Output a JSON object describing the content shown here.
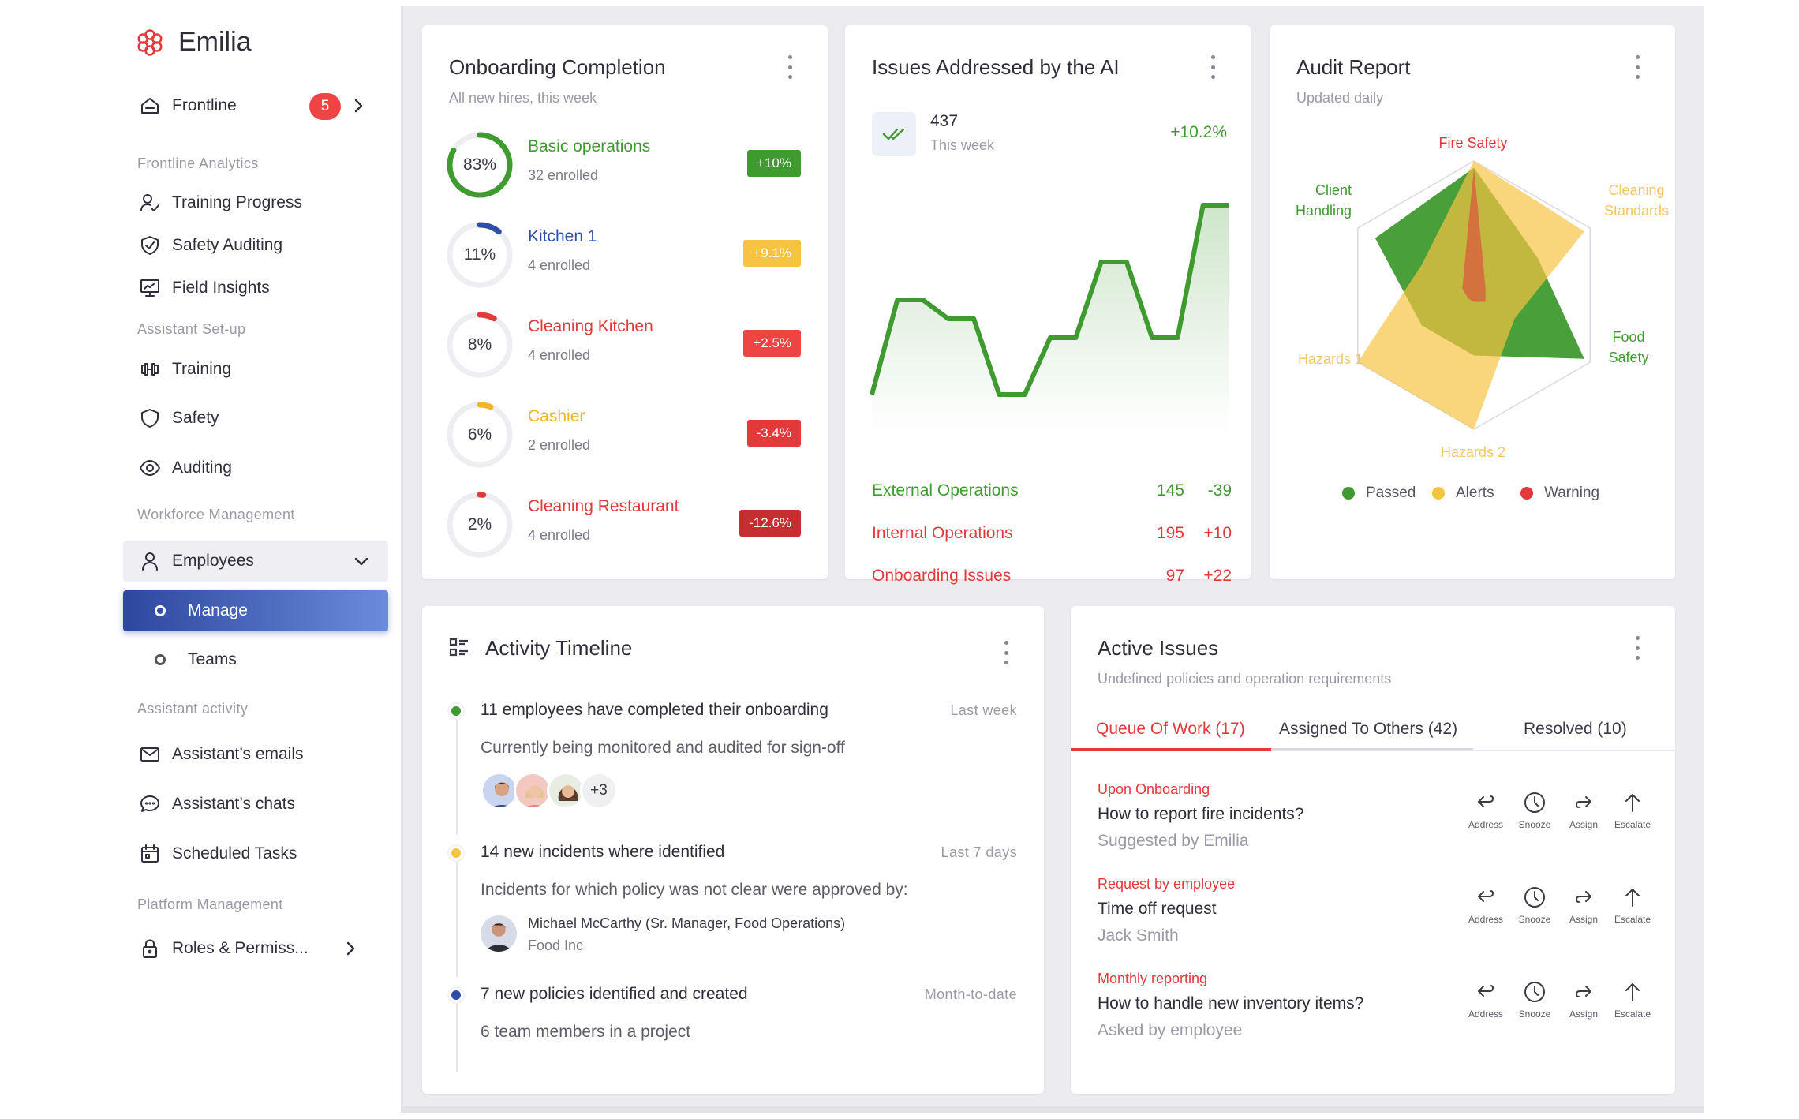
{
  "brand": {
    "name": "Emilia",
    "logo_icon": "flower-icon",
    "accent": "#e2393b"
  },
  "sidebar": {
    "frontline": {
      "label": "Frontline",
      "badge": "5",
      "icon": "home-icon"
    },
    "sections": {
      "analytics": "Frontline Analytics",
      "setup": "Assistant Set-up",
      "workforce": "Workforce Management",
      "activity": "Assistant activity",
      "platform": "Platform Management"
    },
    "analytics_items": [
      {
        "label": "Training Progress",
        "icon": "user-check-icon"
      },
      {
        "label": "Safety Auditing",
        "icon": "shield-check-icon"
      },
      {
        "label": "Field Insights",
        "icon": "monitor-chart-icon"
      }
    ],
    "setup_items": [
      {
        "label": "Training",
        "icon": "dumbbell-icon"
      },
      {
        "label": "Safety",
        "icon": "shield-icon"
      },
      {
        "label": "Auditing",
        "icon": "eye-icon"
      }
    ],
    "employees": {
      "label": "Employees",
      "icon": "user-icon",
      "children": [
        {
          "label": "Manage"
        },
        {
          "label": "Teams"
        }
      ]
    },
    "activity_items": [
      {
        "label": "Assistant’s emails",
        "icon": "mail-icon"
      },
      {
        "label": "Assistant’s chats",
        "icon": "chat-icon"
      },
      {
        "label": "Scheduled Tasks",
        "icon": "calendar-icon"
      }
    ],
    "platform_items": [
      {
        "label": "Roles & Permiss...",
        "icon": "lock-icon"
      }
    ]
  },
  "onboarding": {
    "title": "Onboarding Completion",
    "subtitle": "All new hires, this week",
    "rows": [
      {
        "pct_label": "83%",
        "pct": 83,
        "name": "Basic operations",
        "enrolled": "32 enrolled",
        "change": "+10%",
        "name_color": "#3f9a2f",
        "ring_color": "#3f9a2f",
        "chip_color": "#3f9a2f"
      },
      {
        "pct_label": "11%",
        "pct": 11,
        "name": "Kitchen 1",
        "enrolled": "4 enrolled",
        "change": "+9.1%",
        "name_color": "#2e4fa8",
        "ring_color": "#2e4fa8",
        "chip_color": "#f6c343"
      },
      {
        "pct_label": "8%",
        "pct": 8,
        "name": "Cleaning Kitchen",
        "enrolled": "4 enrolled",
        "change": "+2.5%",
        "name_color": "#e2393b",
        "ring_color": "#e2393b",
        "chip_color": "#ef4444"
      },
      {
        "pct_label": "6%",
        "pct": 6,
        "name": "Cashier",
        "enrolled": "2 enrolled",
        "change": "-3.4%",
        "name_color": "#f0b429",
        "ring_color": "#f0b429",
        "chip_color": "#e2393b"
      },
      {
        "pct_label": "2%",
        "pct": 2,
        "name": "Cleaning Restaurant",
        "enrolled": "4 enrolled",
        "change": "-12.6%",
        "name_color": "#e2393b",
        "ring_color": "#e2393b",
        "chip_color": "#c62f32"
      }
    ]
  },
  "ai": {
    "title": "Issues Addressed by the AI",
    "count": "437",
    "period": "This week",
    "change": "+10.2%",
    "icon": "double-check-icon",
    "series_color": "#3f9a2f",
    "chart_data": {
      "type": "area",
      "values": [
        0,
        5,
        5,
        4,
        4,
        0,
        0,
        3,
        3,
        7,
        7,
        3,
        3,
        10,
        10
      ]
    },
    "rows": [
      {
        "label": "External Operations",
        "value": "145",
        "delta": "-39",
        "color": "#3f9a2f"
      },
      {
        "label": "Internal Operations",
        "value": "195",
        "delta": "+10",
        "color": "#e2393b"
      },
      {
        "label": "Onboarding Issues",
        "value": "97",
        "delta": "+22",
        "color": "#e2393b"
      }
    ]
  },
  "audit": {
    "title": "Audit Report",
    "subtitle": "Updated daily",
    "axes": [
      "Fire Safety",
      "Cleaning\nStandards",
      "Food\nSafety",
      "Hazards 2",
      "Hazards 1",
      "Client\nHandling"
    ],
    "axis_colors": [
      "#e2393b",
      "#f0c66a",
      "#3f9a2f",
      "#f0c66a",
      "#f0c66a",
      "#3f9a2f"
    ],
    "chart_data": {
      "type": "radar",
      "max": 1,
      "series": [
        {
          "name": "Passed",
          "color": "#3f9a2f",
          "values": [
            0.95,
            0.55,
            0.95,
            0.45,
            0.45,
            0.85
          ]
        },
        {
          "name": "Alerts",
          "color": "#f6c343",
          "values": [
            1.0,
            0.95,
            0.35,
            1.0,
            1.0,
            0.45
          ]
        },
        {
          "name": "Warning",
          "color": "#e2393b",
          "values": [
            0.95,
            0.1,
            0.1,
            0.05,
            0.05,
            0.1
          ]
        }
      ]
    },
    "legend": [
      {
        "label": "Passed",
        "color": "#3f9a2f"
      },
      {
        "label": "Alerts",
        "color": "#f6c343"
      },
      {
        "label": "Warning",
        "color": "#e2393b"
      }
    ]
  },
  "timeline": {
    "title": "Activity Timeline",
    "icon": "timeline-list-icon",
    "items": [
      {
        "title": "11 employees have completed their onboarding",
        "time": "Last week",
        "text": "Currently being monitored and audited for sign-off",
        "dot": "#3f9a2f",
        "more": "+3"
      },
      {
        "title": "14 new incidents where identified",
        "time": "Last 7 days",
        "text": "Incidents for which policy was not clear were approved by:",
        "dot": "#f6c343",
        "person": "Michael McCarthy (Sr. Manager, Food Operations)",
        "company": "Food Inc"
      },
      {
        "title": "7 new policies identified and created",
        "time": "Month-to-date",
        "text": "6 team members in a project",
        "dot": "#2e4fa8"
      }
    ]
  },
  "issues": {
    "title": "Active Issues",
    "subtitle": "Undefined policies and operation requirements",
    "tabs": [
      "Queue Of Work (17)",
      "Assigned To Others (42)",
      "Resolved (10)"
    ],
    "actions": [
      {
        "label": "Address",
        "icon": "reply-icon"
      },
      {
        "label": "Snooze",
        "icon": "clock-icon"
      },
      {
        "label": "Assign",
        "icon": "forward-icon"
      },
      {
        "label": "Escalate",
        "icon": "arrow-up-icon"
      }
    ],
    "items": [
      {
        "category": "Upon Onboarding",
        "question": "How to report fire incidents?",
        "by": "Suggested by Emilia"
      },
      {
        "category": "Request by employee",
        "question": "Time off request",
        "by": "Jack Smith"
      },
      {
        "category": "Monthly reporting",
        "question": "How to handle new inventory items?",
        "by": "Asked by employee"
      }
    ]
  }
}
